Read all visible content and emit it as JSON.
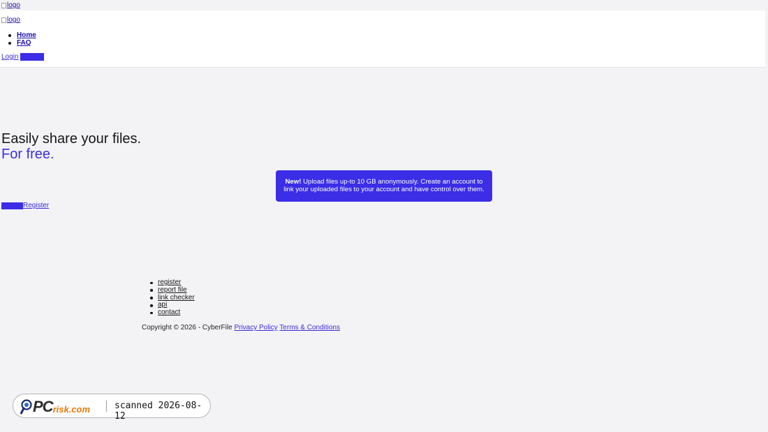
{
  "header": {
    "logo_alt_top": "logo",
    "logo_alt": "logo",
    "nav": [
      "Home",
      "FAQ"
    ],
    "login_label": "Login"
  },
  "hero": {
    "title": "Easily share your files.",
    "subtitle": "For free.",
    "notice_bold": "New!",
    "notice_text": " Upload files up-to 10 GB anonymously. Create an account to link your uploaded files to your account and have control over them.",
    "register_label": "Register"
  },
  "footer": {
    "links": [
      "register",
      "report file",
      "link checker",
      "api",
      "contact"
    ],
    "copyright": "Copyright © 2026 - CyberFile",
    "privacy_label": "Privacy Policy",
    "terms_label": "Terms & Conditions"
  },
  "badge": {
    "brand_pc": "PC",
    "brand_rest": "risk.com",
    "scan_text": "scanned 2026-08-12"
  },
  "colors": {
    "accent": "#3b2ee6",
    "background": "#f3f3f5",
    "badge_orange": "#e07a10"
  }
}
